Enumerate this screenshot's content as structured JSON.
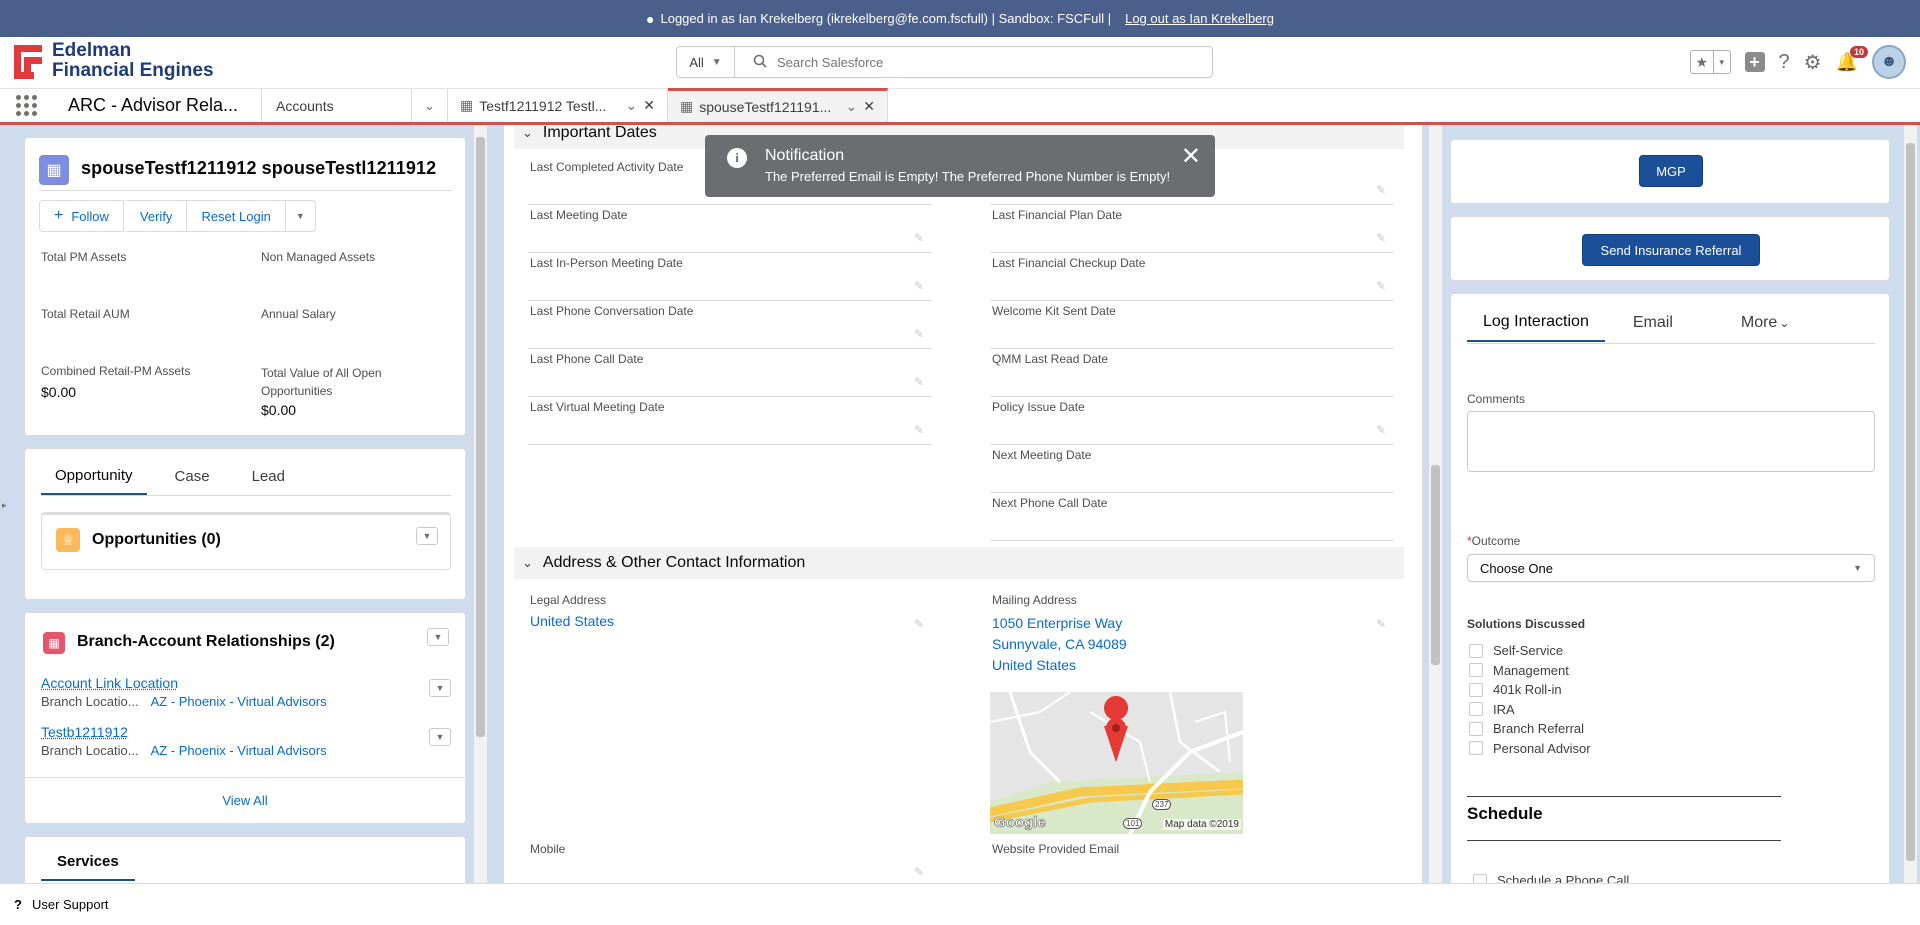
{
  "banner": {
    "text": "Logged in as Ian Krekelberg (ikrekelberg@fe.com.fscfull) | Sandbox: FSCFull |",
    "logout": "Log out as Ian Krekelberg"
  },
  "brand": {
    "line1": "Edelman",
    "line2": "Financial Engines",
    "accent": "#e03a3e"
  },
  "search": {
    "scope": "All",
    "placeholder": "Search Salesforce"
  },
  "notifications": {
    "count": "10"
  },
  "nav": {
    "app_name": "ARC - Advisor Rela...",
    "object": "Accounts",
    "tabs": [
      {
        "label": "Testf1211912 Testl..."
      },
      {
        "label": "spouseTestf121191..."
      }
    ]
  },
  "record": {
    "title": "spouseTestf1211912 spouseTestl1211912",
    "actions": {
      "follow": "Follow",
      "verify": "Verify",
      "reset": "Reset Login"
    },
    "fields": [
      {
        "label": "Total PM Assets",
        "value": ""
      },
      {
        "label": "Non Managed Assets",
        "value": ""
      },
      {
        "label": "Total Retail AUM",
        "value": ""
      },
      {
        "label": "Annual Salary",
        "value": ""
      },
      {
        "label": "Combined Retail-PM Assets",
        "value": "$0.00"
      },
      {
        "label": "Total Value of All Open Opportunities",
        "value": "$0.00"
      }
    ]
  },
  "related_tabs": {
    "tabs": [
      "Opportunity",
      "Case",
      "Lead"
    ],
    "opps_title": "Opportunities (0)"
  },
  "branch": {
    "title": "Branch-Account Relationships (2)",
    "items": [
      {
        "name": "Account Link Location",
        "label": "Branch Locatio...",
        "value": "AZ - Phoenix - Virtual Advisors"
      },
      {
        "name": "Testb1211912",
        "label": "Branch Locatio...",
        "value": "AZ - Phoenix - Virtual Advisors"
      }
    ],
    "view_all": "View All"
  },
  "services": {
    "tab": "Services"
  },
  "center": {
    "sec1": "Important Dates",
    "left_fields": [
      "Last Completed Activity Date",
      "Last Meeting Date",
      "Last In-Person Meeting Date",
      "Last Phone Conversation Date",
      "Last Phone Call Date",
      "Last Virtual Meeting Date"
    ],
    "right_fields": [
      "",
      "Last Financial Plan Date",
      "Last Financial Checkup Date",
      "Welcome Kit Sent Date",
      "QMM Last Read Date",
      "Policy Issue Date",
      "Next Meeting Date",
      "Next Phone Call Date"
    ],
    "sec2": "Address & Other Contact Information",
    "legal_label": "Legal Address",
    "legal_value": "United States",
    "mailing_label": "Mailing Address",
    "mailing_lines": [
      "1050 Enterprise Way",
      "Sunnyvale, CA 94089",
      "United States"
    ],
    "map": {
      "google": "Google",
      "attrib": "Map data ©2019",
      "shield1": "237",
      "shield2": "101"
    },
    "mobile_label": "Mobile",
    "email_label": "Website Provided Email"
  },
  "toast": {
    "title": "Notification",
    "message": "The Preferred Email is Empty! The Preferred Phone Number is Empty!"
  },
  "right": {
    "mgp": "MGP",
    "insurance": "Send Insurance Referral",
    "tabs": [
      "Log Interaction",
      "Email",
      "More"
    ],
    "comments_label": "Comments",
    "outcome_label": "Outcome",
    "outcome_value": "Choose One",
    "solutions_label": "Solutions Discussed",
    "solutions": [
      "Self-Service",
      "Management",
      "401k Roll-in",
      "IRA",
      "Branch Referral",
      "Personal Advisor"
    ],
    "schedule": "Schedule",
    "schedule_call": "Schedule a Phone Call"
  },
  "footer": {
    "label": "User Support"
  }
}
